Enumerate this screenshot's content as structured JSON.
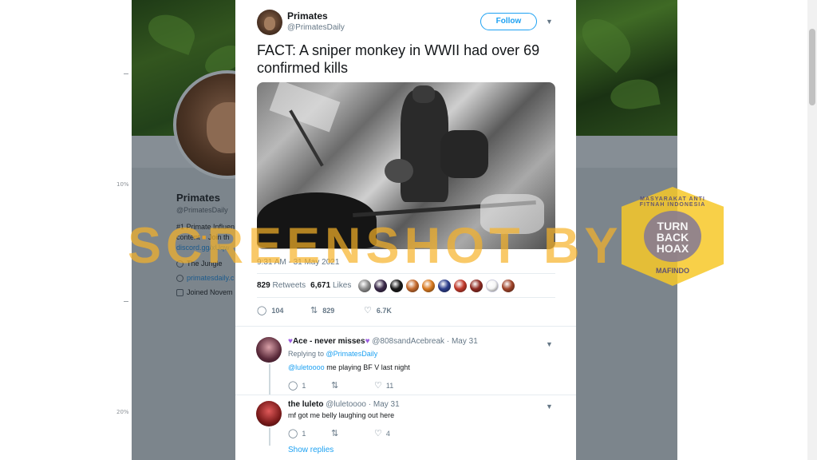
{
  "ruler": {
    "mark_10": "10%",
    "mark_20": "20%"
  },
  "profile": {
    "name": "Primates",
    "handle": "@PrimatesDaily",
    "bio_line1": "#1 Primate Influen",
    "bio_line2_a": "content",
    "bio_line2_b": "Join th",
    "bio_link": "discord.gg/xUqw",
    "location": "The Jungle",
    "website": "primatesdaily.c",
    "joined": "Joined Novem"
  },
  "tweet": {
    "author_name": "Primates",
    "author_handle": "@PrimatesDaily",
    "follow_label": "Follow",
    "text": "FACT: A sniper monkey in WWII had over 69 confirmed kills",
    "timestamp": "9:31 AM - 31 May 2021",
    "retweets_count": "829",
    "retweets_label": "Retweets",
    "likes_count": "6,671",
    "likes_label": "Likes",
    "reply_count": "104",
    "retweet_count_short": "829",
    "like_count_short": "6.7K"
  },
  "likers": {
    "colors": [
      "#8c8c8c",
      "#3b2a4a",
      "#1a1a1a",
      "#c46a2d",
      "#d97a20",
      "#2d3e8c",
      "#c0392b",
      "#8e2a22",
      "#f5f5f5",
      "#a0442a"
    ]
  },
  "replies": [
    {
      "name": "Ace - never misses",
      "handle": "@808sandAcebreak",
      "date": "May 31",
      "replying_label": "Replying to",
      "replying_to": "@PrimatesDaily",
      "mention": "@luletoooo",
      "text": "me playing BF V last night",
      "replies": "1",
      "likes": "11"
    },
    {
      "name": "the luleto",
      "handle": "@luletoooo",
      "date": "May 31",
      "text": "mf got me belly laughing out here",
      "replies": "1",
      "likes": "4"
    }
  ],
  "show_replies_label": "Show replies",
  "watermark": {
    "text": "SCREENSHOT BY",
    "badge_title": "TURN BACK HOAX",
    "badge_ring": "MASYARAKAT ANTI FITNAH INDONESIA",
    "badge_bottom": "MAFINDO"
  },
  "colors": {
    "accent": "#1da1f2",
    "watermark": "#f7b228",
    "overlay": "#6f7880"
  }
}
